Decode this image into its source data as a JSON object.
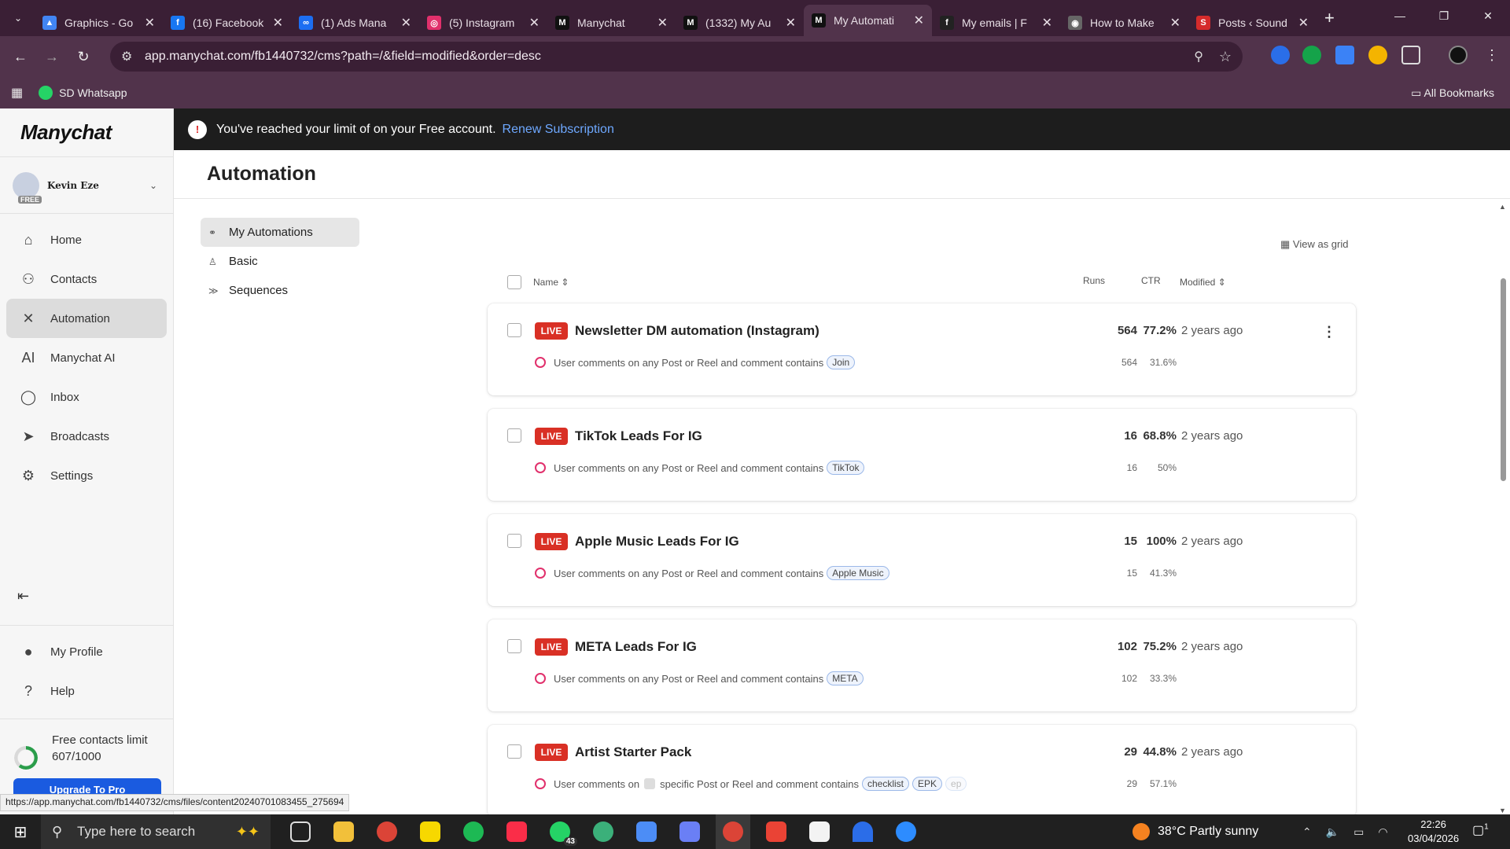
{
  "browser": {
    "tabs": [
      {
        "title": "Graphics - Go",
        "color": "#4285f4",
        "glyph": "▲"
      },
      {
        "title": "(16) Facebook",
        "color": "#1877f2",
        "glyph": "f"
      },
      {
        "title": "(1) Ads Mana",
        "color": "#1c6ef2",
        "glyph": "∞"
      },
      {
        "title": "(5) Instagram",
        "color": "#e1306c",
        "glyph": "◎"
      },
      {
        "title": "Manychat",
        "color": "#111111",
        "glyph": "M"
      },
      {
        "title": "(1332) My Au",
        "color": "#111111",
        "glyph": "M"
      },
      {
        "title": "My Automati",
        "color": "#111111",
        "glyph": "M"
      },
      {
        "title": "My emails | F",
        "color": "#222222",
        "glyph": "f"
      },
      {
        "title": "How to Make",
        "color": "#666666",
        "glyph": "◉"
      },
      {
        "title": "Posts ‹ Sound",
        "color": "#d52b2b",
        "glyph": "S"
      }
    ],
    "active_tab_index": 6,
    "url": "app.manychat.com/fb1440732/cms?path=/&field=modified&order=desc",
    "bookmarks": [
      {
        "label": "SD Whatsapp"
      }
    ],
    "all_bookmarks_label": "All Bookmarks",
    "status_url": "https://app.manychat.com/fb1440732/cms/files/content20240701083455_275694"
  },
  "sidebar": {
    "logo": "Manychat",
    "account_name": "Kevin Eze",
    "account_badge": "FREE",
    "items": [
      {
        "label": "Home",
        "icon": "home-icon",
        "glyph": "⌂"
      },
      {
        "label": "Contacts",
        "icon": "person-icon",
        "glyph": "⚇"
      },
      {
        "label": "Automation",
        "icon": "automation-icon",
        "glyph": "✕",
        "active": true
      },
      {
        "label": "Manychat AI",
        "icon": "ai-icon",
        "glyph": "AI"
      },
      {
        "label": "Inbox",
        "icon": "chat-icon",
        "glyph": "◯"
      },
      {
        "label": "Broadcasts",
        "icon": "send-icon",
        "glyph": "➤"
      },
      {
        "label": "Settings",
        "icon": "gear-icon",
        "glyph": "⚙"
      }
    ],
    "bottom_items": [
      {
        "label": "My Profile",
        "icon": "profile-icon",
        "glyph": "●"
      },
      {
        "label": "Help",
        "icon": "help-icon",
        "glyph": "?"
      }
    ],
    "limit_label": "Free contacts limit",
    "limit_value": "607/1000",
    "limit_fraction": 0.607,
    "upgrade_label": "Upgrade To Pro"
  },
  "banner": {
    "message": "You've reached your limit of on your Free account.",
    "link": "Renew Subscription"
  },
  "page": {
    "title": "Automation",
    "subnav": [
      {
        "label": "My Automations",
        "icon": "flow-icon",
        "active": true
      },
      {
        "label": "Basic",
        "icon": "basic-icon"
      },
      {
        "label": "Sequences",
        "icon": "sequences-icon"
      }
    ],
    "view_grid_label": "View as grid",
    "columns": {
      "name": "Name",
      "runs": "Runs",
      "ctr": "CTR",
      "modified": "Modified"
    }
  },
  "automations": [
    {
      "status": "LIVE",
      "name": "Newsletter DM automation (Instagram)",
      "runs": "564",
      "ctr": "77.2%",
      "modified": "2 years ago",
      "trigger_pre": "User comments on any Post or Reel and comment contains",
      "keywords": [
        "Join"
      ],
      "runs_sub": "564",
      "ctr_sub": "31.6%"
    },
    {
      "status": "LIVE",
      "name": "TikTok Leads For IG",
      "runs": "16",
      "ctr": "68.8%",
      "modified": "2 years ago",
      "trigger_pre": "User comments on any Post or Reel and comment contains",
      "keywords": [
        "TikTok"
      ],
      "runs_sub": "16",
      "ctr_sub": "50%"
    },
    {
      "status": "LIVE",
      "name": "Apple Music Leads For IG",
      "runs": "15",
      "ctr": "100%",
      "modified": "2 years ago",
      "trigger_pre": "User comments on any Post or Reel and comment contains",
      "keywords": [
        "Apple Music"
      ],
      "runs_sub": "15",
      "ctr_sub": "41.3%"
    },
    {
      "status": "LIVE",
      "name": "META Leads For IG",
      "runs": "102",
      "ctr": "75.2%",
      "modified": "2 years ago",
      "trigger_pre": "User comments on any Post or Reel and comment contains",
      "keywords": [
        "META"
      ],
      "runs_sub": "102",
      "ctr_sub": "33.3%"
    },
    {
      "status": "LIVE",
      "name": "Artist Starter Pack",
      "runs": "29",
      "ctr": "44.8%",
      "modified": "2 years ago",
      "trigger_pre": "User comments on",
      "trigger_mid": "specific Post or Reel and comment contains",
      "keywords": [
        "checklist",
        "EPK",
        "ep"
      ],
      "runs_sub": "29",
      "ctr_sub": "57.1%"
    }
  ],
  "taskbar": {
    "search_placeholder": "Type here to search",
    "weather": "38°C  Partly sunny",
    "time": "22:26",
    "date": "03/04/2026",
    "whatsapp_badge": "43",
    "notif_count": "1"
  }
}
